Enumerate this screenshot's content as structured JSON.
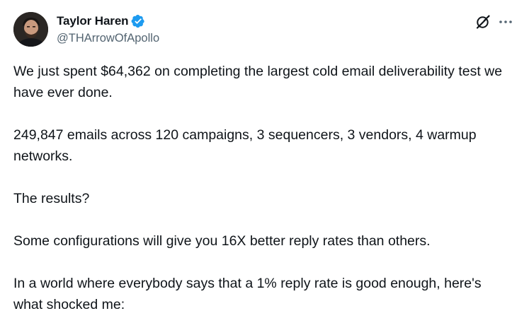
{
  "author": {
    "display_name": "Taylor Haren",
    "handle": "@THArrowOfApollo",
    "verified_color": "#1d9bf0"
  },
  "actions": {
    "grok_icon": "grok-icon",
    "more_icon": "more-icon"
  },
  "tweet": {
    "paragraphs": [
      "We just spent $64,362 on completing the largest cold email deliverability test we have ever done.",
      "249,847 emails across 120 campaigns, 3 sequencers, 3 vendors, 4 warmup networks.",
      "The results?",
      "Some configurations will give you 16X better reply rates than others.",
      "In a world where everybody says that a 1% reply rate is good enough, here's what shocked me:"
    ]
  },
  "colors": {
    "text": "#0f1419",
    "secondary": "#536471",
    "accent": "#1d9bf0"
  }
}
